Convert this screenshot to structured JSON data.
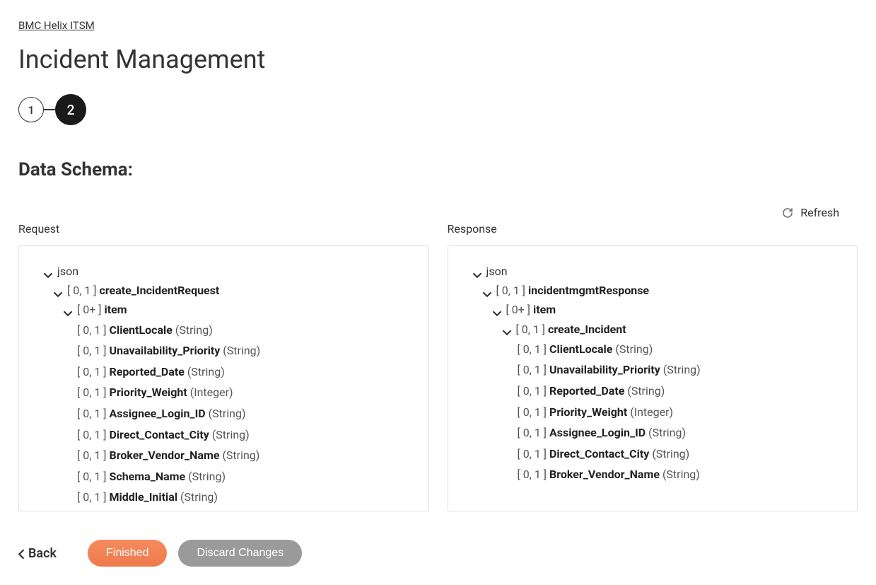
{
  "breadcrumb": "BMC Helix ITSM",
  "page_title": "Incident Management",
  "stepper": {
    "step1": "1",
    "step2": "2",
    "active": 2
  },
  "section_heading": "Data Schema:",
  "refresh_label": "Refresh",
  "panels": {
    "request": {
      "label": "Request",
      "root": "json",
      "group1": {
        "card": "[ 0, 1 ] ",
        "name": "create_IncidentRequest"
      },
      "group2": {
        "card": "[ 0+ ] ",
        "name": "item"
      },
      "fields": [
        {
          "card": "[ 0, 1 ] ",
          "name": "ClientLocale",
          "type": " (String)"
        },
        {
          "card": "[ 0, 1 ] ",
          "name": "Unavailability_Priority",
          "type": " (String)"
        },
        {
          "card": "[ 0, 1 ] ",
          "name": "Reported_Date",
          "type": " (String)"
        },
        {
          "card": "[ 0, 1 ] ",
          "name": "Priority_Weight",
          "type": " (Integer)"
        },
        {
          "card": "[ 0, 1 ] ",
          "name": "Assignee_Login_ID",
          "type": " (String)"
        },
        {
          "card": "[ 0, 1 ] ",
          "name": "Direct_Contact_City",
          "type": " (String)"
        },
        {
          "card": "[ 0, 1 ] ",
          "name": "Broker_Vendor_Name",
          "type": " (String)"
        },
        {
          "card": "[ 0, 1 ] ",
          "name": "Schema_Name",
          "type": " (String)"
        },
        {
          "card": "[ 0, 1 ] ",
          "name": "Middle_Initial",
          "type": " (String)"
        }
      ]
    },
    "response": {
      "label": "Response",
      "root": "json",
      "group1": {
        "card": "[ 0, 1 ] ",
        "name": "incidentmgmtResponse"
      },
      "group2": {
        "card": "[ 0+ ] ",
        "name": "item"
      },
      "group3": {
        "card": "[ 0, 1 ] ",
        "name": "create_Incident"
      },
      "fields": [
        {
          "card": "[ 0, 1 ] ",
          "name": "ClientLocale",
          "type": " (String)"
        },
        {
          "card": "[ 0, 1 ] ",
          "name": "Unavailability_Priority",
          "type": " (String)"
        },
        {
          "card": "[ 0, 1 ] ",
          "name": "Reported_Date",
          "type": " (String)"
        },
        {
          "card": "[ 0, 1 ] ",
          "name": "Priority_Weight",
          "type": " (Integer)"
        },
        {
          "card": "[ 0, 1 ] ",
          "name": "Assignee_Login_ID",
          "type": " (String)"
        },
        {
          "card": "[ 0, 1 ] ",
          "name": "Direct_Contact_City",
          "type": " (String)"
        },
        {
          "card": "[ 0, 1 ] ",
          "name": "Broker_Vendor_Name",
          "type": " (String)"
        }
      ]
    }
  },
  "footer": {
    "back": "Back",
    "finished": "Finished",
    "discard": "Discard Changes"
  }
}
